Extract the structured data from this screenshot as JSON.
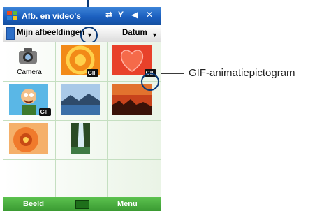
{
  "titlebar": {
    "title": "Afb. en video's",
    "icons": [
      "start-flag-icon",
      "sync-icon",
      "signal-icon",
      "speaker-icon",
      "close-icon"
    ]
  },
  "toolbar": {
    "folder_label": "Mijn afbeeldingen",
    "sort_label": "Datum"
  },
  "grid": {
    "items": [
      {
        "type": "camera",
        "label": "Camera"
      },
      {
        "type": "image",
        "name": "orange-rings",
        "gif": true,
        "badge": "GIF"
      },
      {
        "type": "image",
        "name": "red-heart",
        "gif": true,
        "badge": "GIF"
      },
      {
        "type": "image",
        "name": "cartoon-man",
        "gif": true,
        "badge": "GIF"
      },
      {
        "type": "image",
        "name": "lake-landscape",
        "gif": false
      },
      {
        "type": "image",
        "name": "desert-sunset",
        "gif": false
      },
      {
        "type": "image",
        "name": "orange-flower",
        "gif": false
      },
      {
        "type": "image",
        "name": "waterfall",
        "gif": false
      }
    ]
  },
  "softkeys": {
    "left": "Beeld",
    "right": "Menu"
  },
  "callout": {
    "label": "GIF-animatiepictogram"
  },
  "colors": {
    "titlebar": "#1b5fbf",
    "softbar": "#4aaf40",
    "callout": "#0a3a78"
  }
}
